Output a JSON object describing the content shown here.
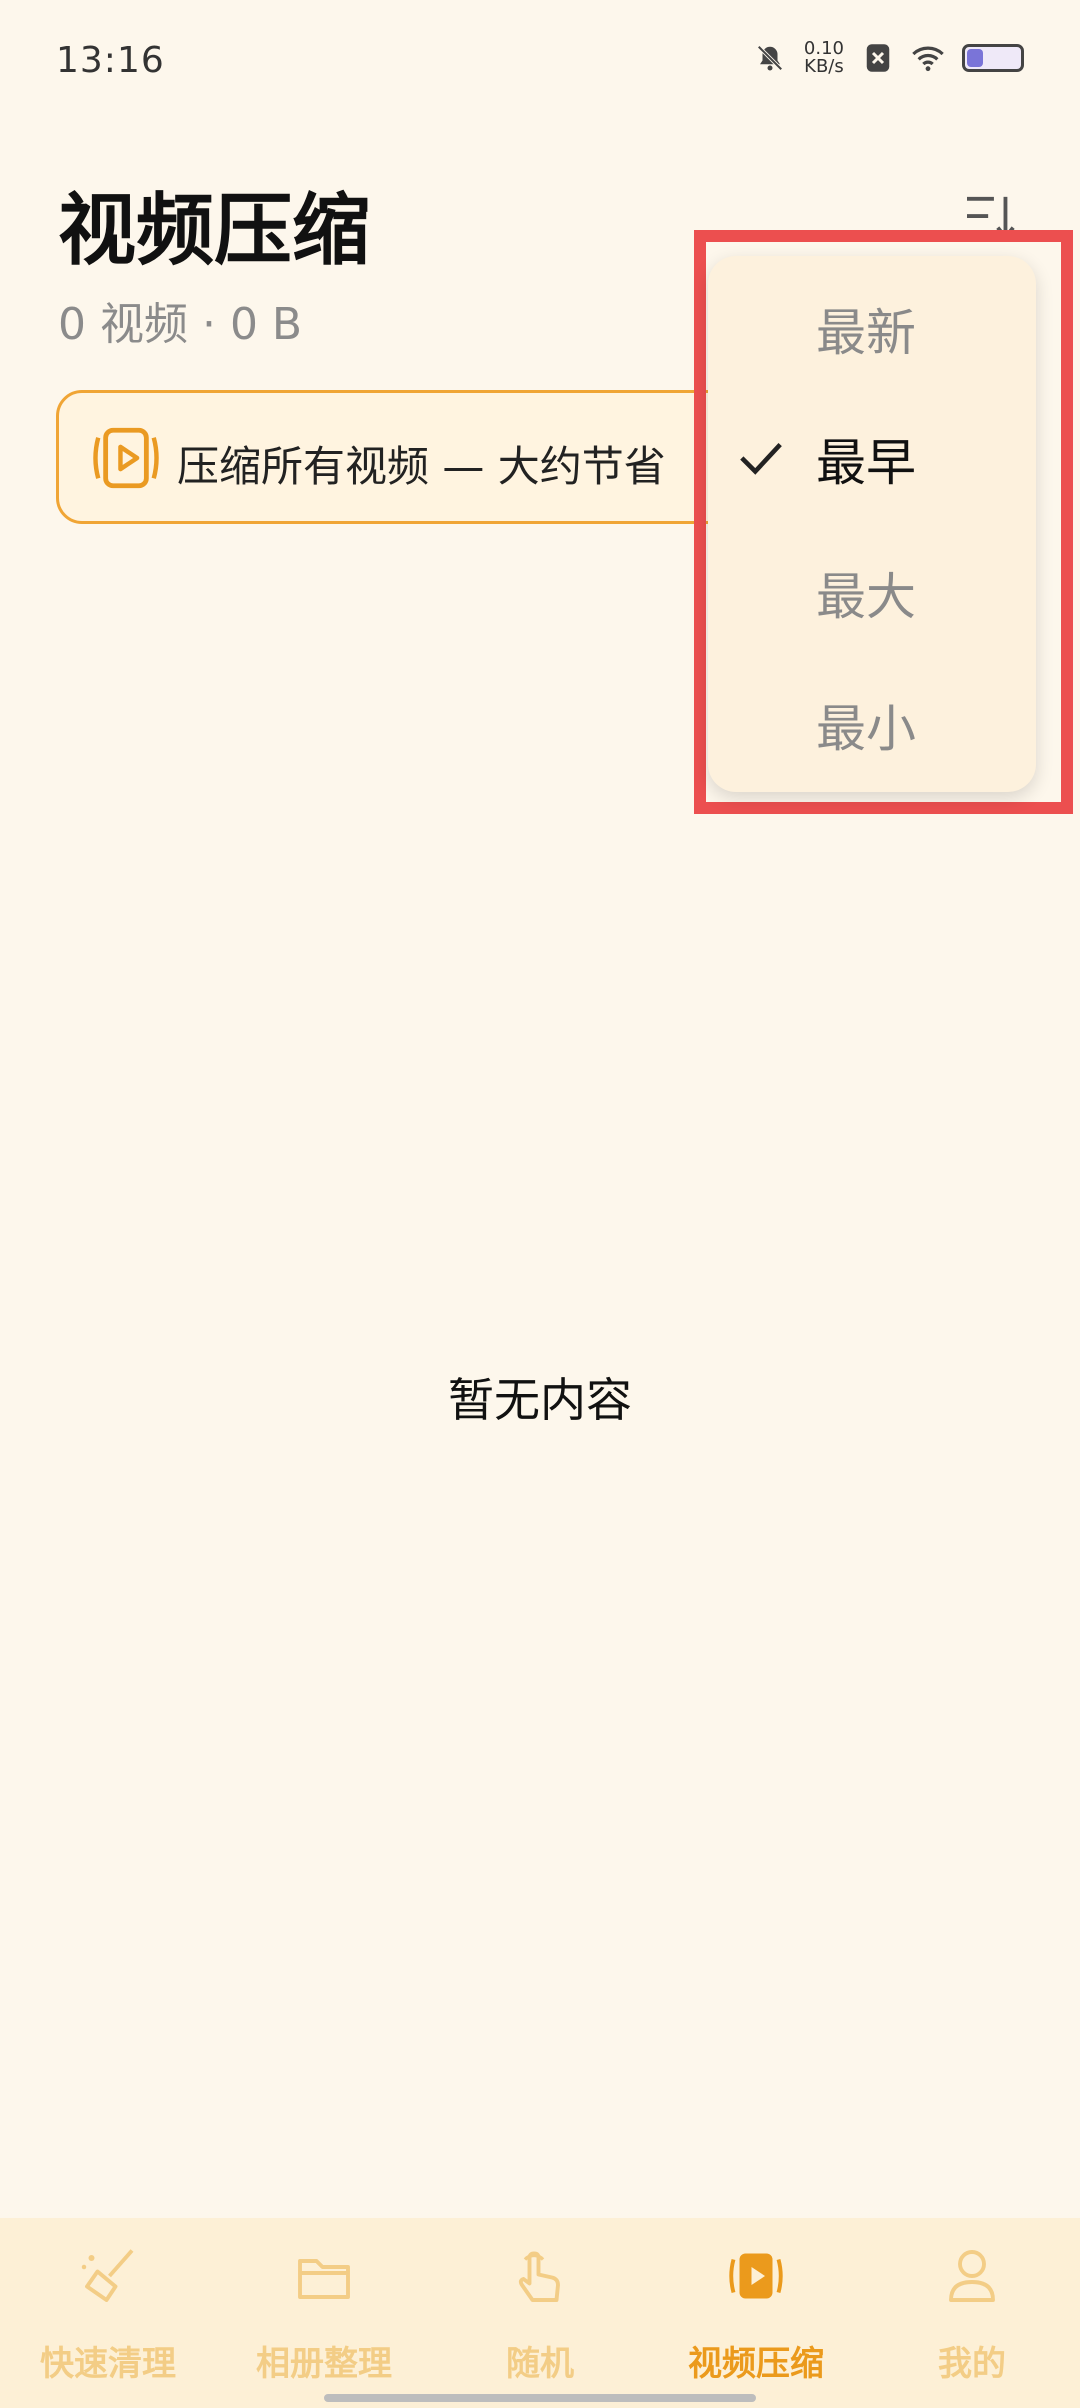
{
  "status_bar": {
    "time": "13:16",
    "net_speed_value": "0.10",
    "net_speed_unit": "KB/s",
    "icons": [
      "bell-off-icon",
      "sim-off-icon",
      "wifi-icon",
      "battery-icon"
    ],
    "battery_level": 0.3
  },
  "header": {
    "title": "视频压缩",
    "subtitle": "0 视频 · 0 B",
    "sort_icon": "sort-descending-icon"
  },
  "banner": {
    "text": "压缩所有视频 — 大约节省",
    "icon": "video-compress-icon"
  },
  "dropdown": {
    "items": [
      {
        "label": "最新",
        "selected": false
      },
      {
        "label": "最早",
        "selected": true
      },
      {
        "label": "最大",
        "selected": false
      },
      {
        "label": "最小",
        "selected": false
      }
    ]
  },
  "empty_state": {
    "text": "暂无内容"
  },
  "bottom_nav": {
    "items": [
      {
        "label": "快速清理",
        "icon": "broom-icon",
        "active": false
      },
      {
        "label": "相册整理",
        "icon": "folder-icon",
        "active": false
      },
      {
        "label": "随机",
        "icon": "tap-hand-icon",
        "active": false
      },
      {
        "label": "视频压缩",
        "icon": "video-compress-icon",
        "active": true
      },
      {
        "label": "我的",
        "icon": "user-icon",
        "active": false
      }
    ]
  },
  "colors": {
    "background": "#fdf7ec",
    "accent": "#eb9a1c",
    "nav_inactive": "#f3cd86",
    "highlight": "#ec4f4f"
  }
}
